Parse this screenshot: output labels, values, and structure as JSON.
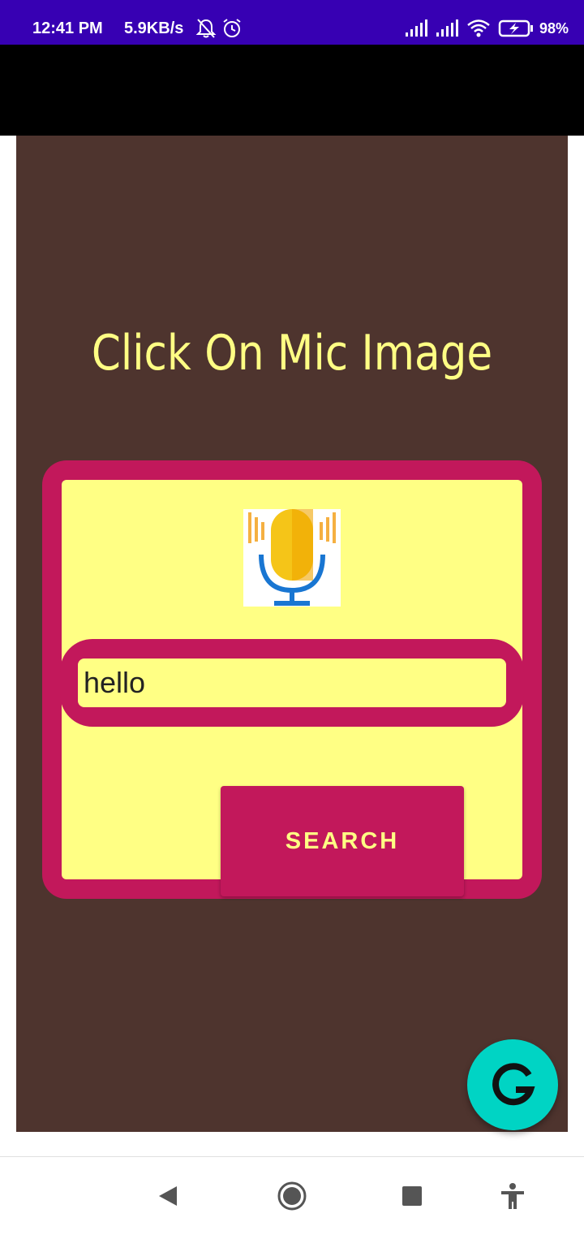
{
  "status_bar": {
    "time": "12:41 PM",
    "net_speed": "5.9KB/s",
    "battery": "98%",
    "icons": [
      "bell-muted-icon",
      "alarm-icon",
      "signal-icon",
      "signal-icon",
      "wifi-icon",
      "battery-charging-icon"
    ],
    "background": "#3700b3"
  },
  "main": {
    "title": "Click On Mic Image",
    "mic_icon": "microphone-icon",
    "input": {
      "value": "hello"
    },
    "search_label": "SEARCH"
  },
  "fab": {
    "icon": "grammarly-icon"
  },
  "nav_bar": {
    "buttons": [
      "back-icon",
      "home-icon",
      "recents-icon",
      "accessibility-icon"
    ]
  },
  "colors": {
    "app_background": "#4e342e",
    "accent": "#c2185b",
    "card": "#ffff84",
    "fab": "#00d4c4"
  }
}
